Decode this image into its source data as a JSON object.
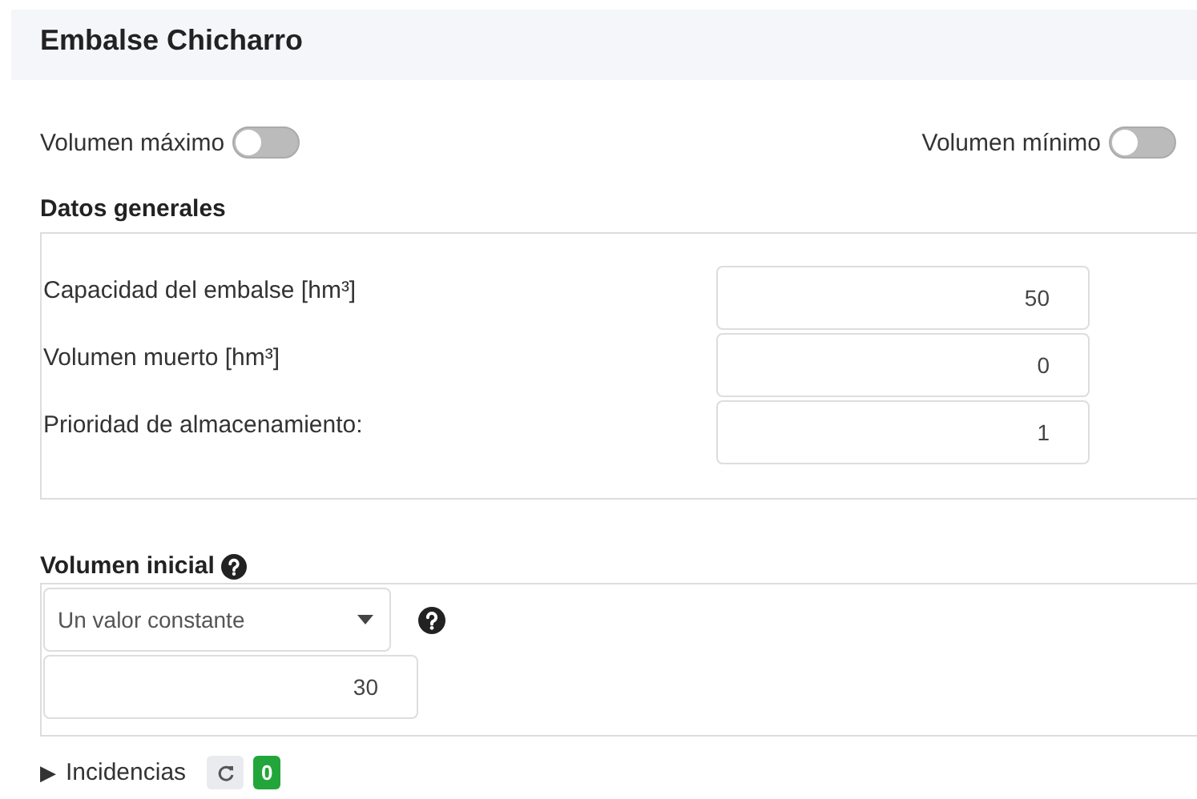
{
  "header": {
    "title": "Embalse Chicharro"
  },
  "toggles": [
    {
      "label": "Volumen máximo",
      "on": false
    },
    {
      "label": "Volumen mínimo",
      "on": false
    }
  ],
  "general": {
    "title": "Datos generales",
    "fields": [
      {
        "label": "Capacidad del embalse [hm³]",
        "value": "50"
      },
      {
        "label": "Volumen muerto [hm³]",
        "value": "0"
      },
      {
        "label": "Prioridad de almacenamiento:",
        "value": "1"
      }
    ]
  },
  "initial": {
    "title": "Volumen inicial",
    "select": "Un valor constante",
    "value": "30"
  },
  "incidents": {
    "arrow": "▶",
    "label": "Incidencias",
    "count": "0"
  }
}
